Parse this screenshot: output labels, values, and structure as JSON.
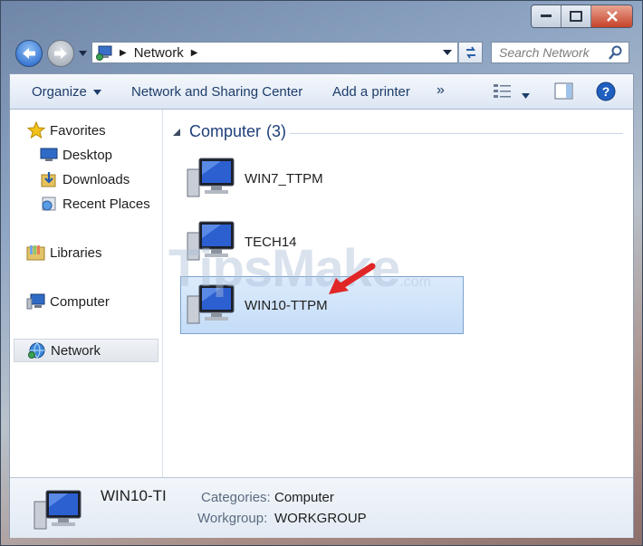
{
  "address": {
    "crumb": "Network"
  },
  "search": {
    "placeholder": "Search Network"
  },
  "toolbar": {
    "organize": "Organize",
    "sharing": "Network and Sharing Center",
    "add_printer": "Add a printer",
    "more": "»"
  },
  "sidebar": {
    "items": [
      {
        "label": "Favorites",
        "icon": "star-icon"
      },
      {
        "label": "Desktop",
        "icon": "desktop-icon"
      },
      {
        "label": "Downloads",
        "icon": "downloads-icon"
      },
      {
        "label": "Recent Places",
        "icon": "recent-places-icon"
      },
      {
        "label": "Libraries",
        "icon": "libraries-icon"
      },
      {
        "label": "Computer",
        "icon": "computer-icon"
      },
      {
        "label": "Network",
        "icon": "network-icon"
      }
    ]
  },
  "main": {
    "group": {
      "title": "Computer",
      "count": "(3)"
    },
    "items": [
      {
        "label": "WIN7_TTPM"
      },
      {
        "label": "TECH14"
      },
      {
        "label": "WIN10-TTPM"
      }
    ]
  },
  "watermark": {
    "text": "TipsMake",
    "suffix": ".com"
  },
  "details": {
    "name": "WIN10-TI",
    "categories_label": "Categories:",
    "categories_value": "Computer",
    "workgroup_label": "Workgroup:",
    "workgroup_value": "WORKGROUP"
  },
  "colors": {
    "accent": "#1e3f7a",
    "selection": "#c4dcf7",
    "arrow": "#e02626"
  }
}
